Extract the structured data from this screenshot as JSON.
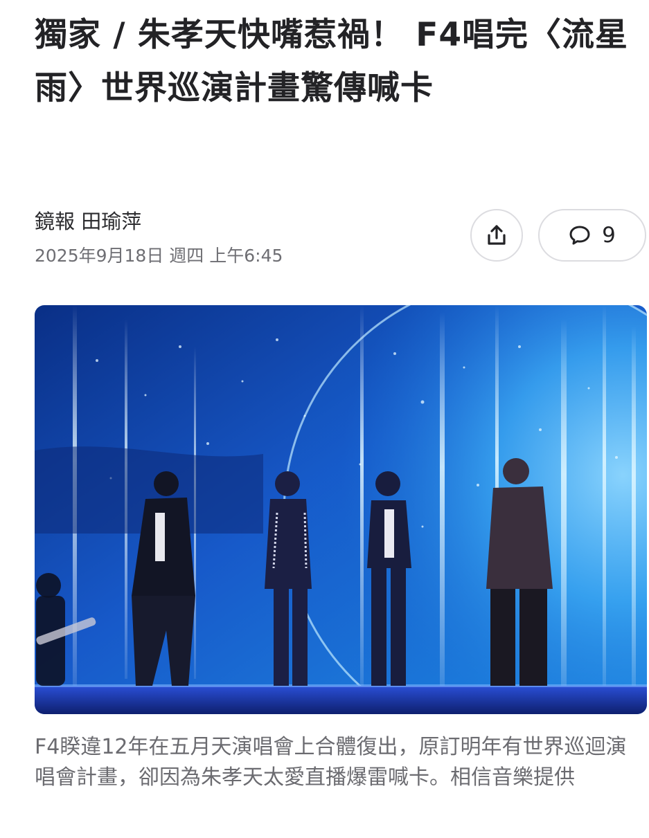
{
  "article": {
    "headline": "獨家 / 朱孝天快嘴惹禍！ F4唱完〈流星雨〉世界巡演計畫驚傳喊卡",
    "author": "鏡報 田瑜萍",
    "timestamp": "2025年9月18日 週四 上午6:45",
    "comment_count": "9",
    "caption": "F4睽違12年在五月天演唱會上合體復出，原訂明年有世界巡迴演唱會計畫，卻因為朱孝天太愛直播爆雷喊卡。相信音樂提供"
  },
  "icons": {
    "share": "share-icon",
    "comment": "comment-bubble-icon"
  },
  "colors": {
    "headline": "#232326",
    "meta": "#6e6e73",
    "button_border": "#dcdce0",
    "stage_blue": "#1e7fd6"
  }
}
